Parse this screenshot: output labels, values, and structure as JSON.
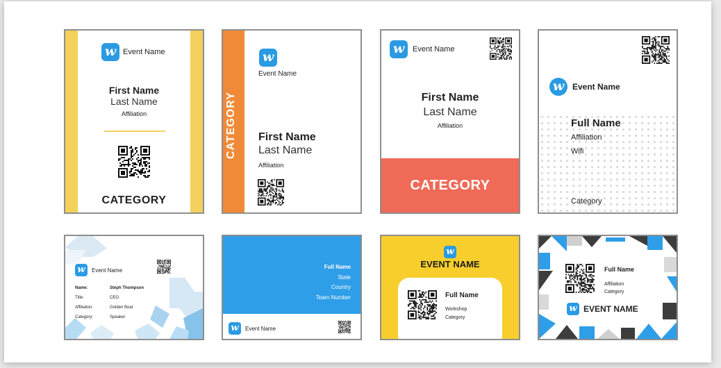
{
  "badges": [
    {
      "event_name": "Event Name",
      "first_name": "First Name",
      "last_name": "Last Name",
      "affiliation": "Affiliation",
      "category": "CATEGORY"
    },
    {
      "event_name": "Event Name",
      "category": "CATEGORY",
      "first_name": "First Name",
      "last_name": "Last Name",
      "affiliation": "Affiliation"
    },
    {
      "event_name": "Event Name",
      "first_name": "First Name",
      "last_name": "Last Name",
      "affiliation": "Affiliation",
      "category": "CATEGORY"
    },
    {
      "event_name": "Event Name",
      "full_name": "Full Name",
      "affiliation": "Affiliation",
      "wifi": "Wifi",
      "category": "Category"
    },
    {
      "event_name": "Event Name",
      "rows": [
        {
          "label": "Name:",
          "value": "Steph Thompson"
        },
        {
          "label": "Title:",
          "value": "CEO"
        },
        {
          "label": "Affiliation:",
          "value": "Golden Boat"
        },
        {
          "label": "Category:",
          "value": "Speaker"
        }
      ]
    },
    {
      "full_name": "Full Name",
      "state": "State",
      "country": "Country",
      "team_number": "Team Number",
      "event_name": "Event Name"
    },
    {
      "event_name": "EVENT NAME",
      "full_name": "Full Name",
      "workshop": "Workshop",
      "category": "Category"
    },
    {
      "full_name": "Full Name",
      "affiliation": "Affiliation",
      "category": "Category",
      "event_name": "EVENT NAME"
    }
  ],
  "logo_glyph": "w",
  "colors": {
    "logo_blue": "#2a9be3",
    "yellow_stripe": "#f2d15c",
    "orange": "#f08a38",
    "coral": "#ef6a57",
    "sky_blue": "#2f9ee8",
    "sun_yellow": "#f7ce2b",
    "dark_gray": "#3d3d3d"
  },
  "icons": [
    "logo-icon",
    "qr-code-icon"
  ]
}
